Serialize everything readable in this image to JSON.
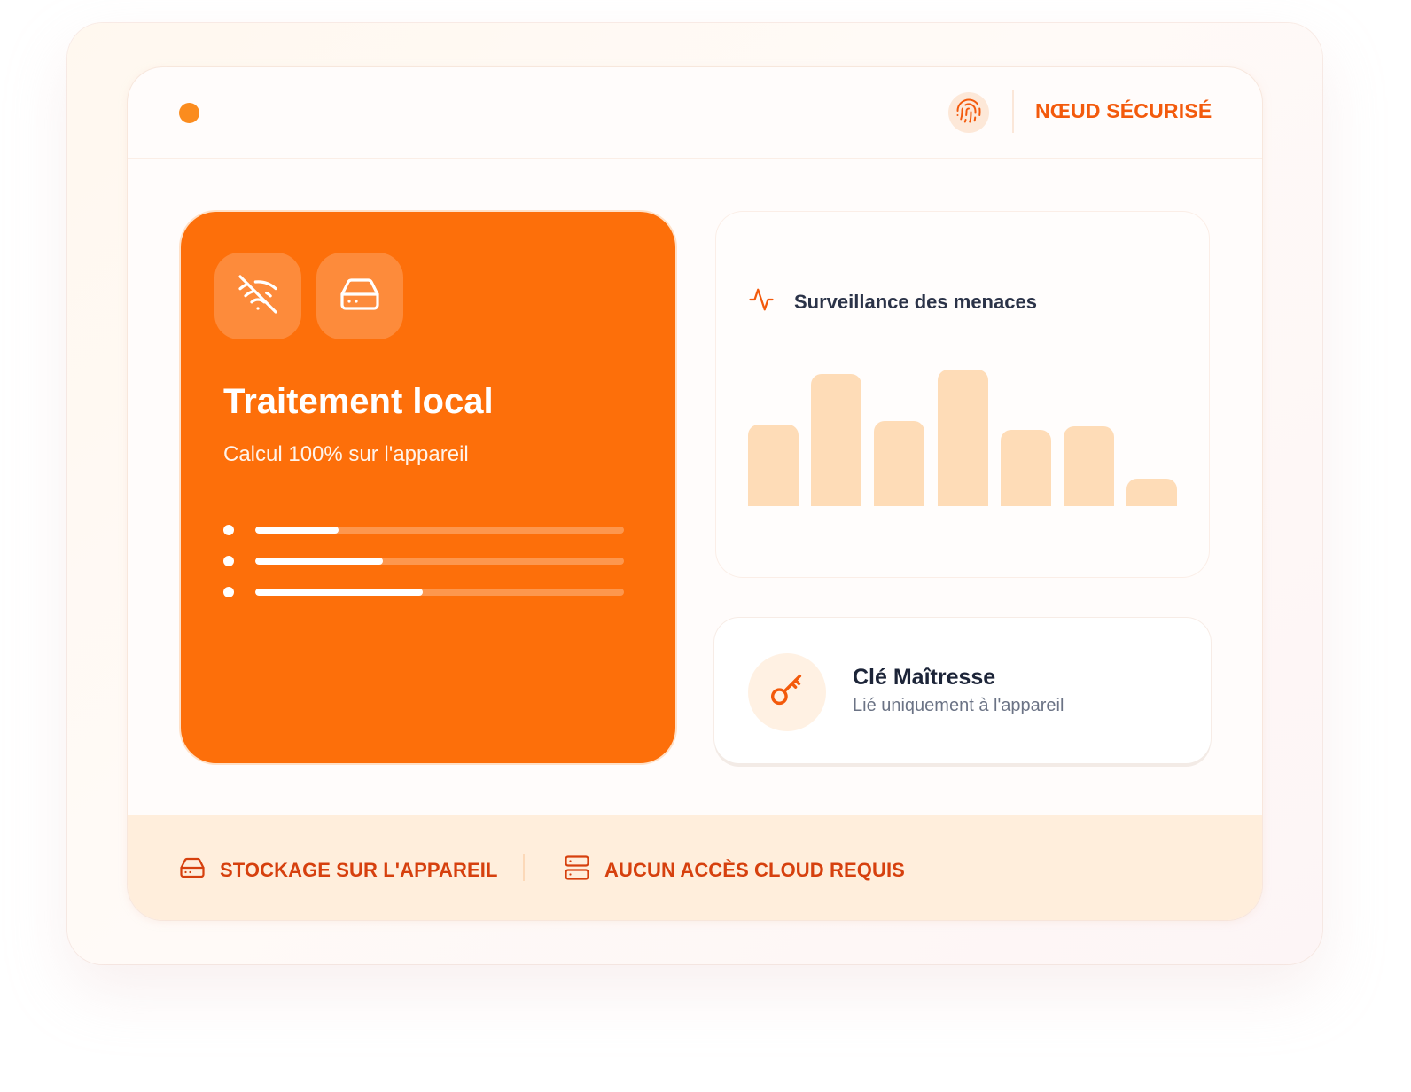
{
  "header": {
    "node_label": "NŒUD SÉCURISÉ",
    "status_icon": "status-dot",
    "badge_icon": "fingerprint-icon"
  },
  "processing": {
    "title": "Traitement local",
    "subtitle": "Calcul 100% sur l'appareil",
    "icons": [
      "wifi-off-icon",
      "hard-drive-icon"
    ],
    "progress": [
      0.225,
      0.345,
      0.455
    ]
  },
  "monitor": {
    "title": "Surveillance des menaces",
    "icon": "activity-icon",
    "chart_data": {
      "type": "bar",
      "values": [
        92,
        149,
        96,
        154,
        86,
        90,
        31
      ]
    }
  },
  "master_key": {
    "title": "Clé Maîtresse",
    "subtitle": "Lié uniquement à l'appareil",
    "icon": "key-icon"
  },
  "footer": {
    "storage_label": "STOCKAGE SUR L'APPAREIL",
    "cloud_label": "AUCUN ACCÈS CLOUD REQUIS",
    "icons": [
      "hard-drive-icon",
      "server-icon"
    ]
  },
  "colors": {
    "accent": "#fd6f0a",
    "accent_text": "#f35a0c",
    "bar": "#fedcb7",
    "footer_bg": "#ffeedc"
  }
}
